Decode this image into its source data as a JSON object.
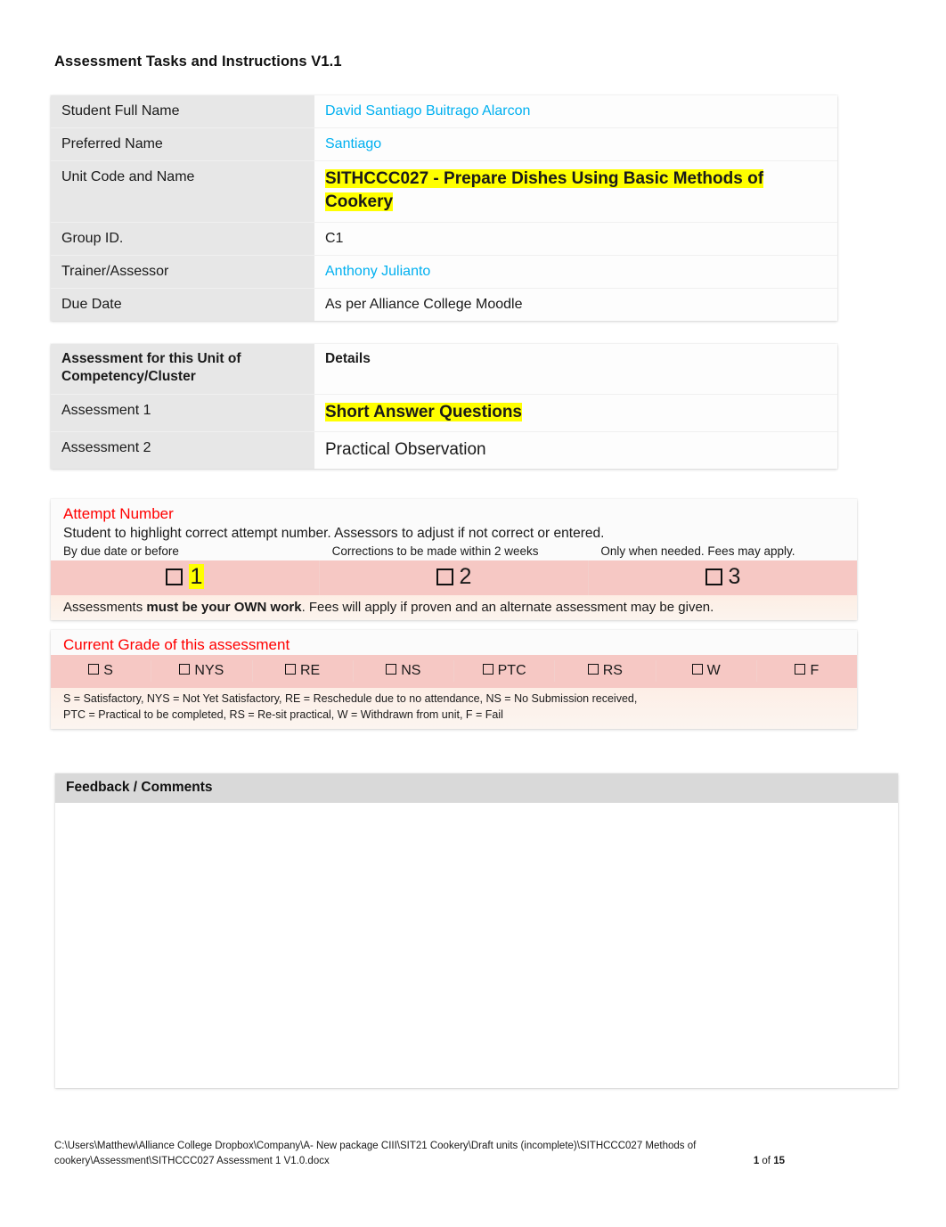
{
  "document": {
    "title": "Assessment Tasks and Instructions V1.1"
  },
  "student_table": {
    "rows": [
      {
        "label": "Student Full Name",
        "value": "David Santiago Buitrago Alarcon",
        "style": "blue"
      },
      {
        "label": "Preferred Name",
        "value": "Santiago",
        "style": "blue"
      },
      {
        "label": "Unit Code and Name",
        "value": "SITHCCC027 - Prepare Dishes Using Basic Methods of Cookery",
        "style": "highlight-yellow-bold"
      },
      {
        "label": "Group ID.",
        "value": "C1",
        "style": "plain"
      },
      {
        "label": "Trainer/Assessor",
        "value": "Anthony Julianto",
        "style": "blue"
      },
      {
        "label": "Due Date",
        "value": "As per Alliance College Moodle",
        "style": "plain"
      }
    ]
  },
  "assessment_table": {
    "header_label": "Assessment for this Unit of Competency/Cluster",
    "header_details": "Details",
    "rows": [
      {
        "label": "Assessment 1",
        "value": "Short Answer Questions",
        "style": "highlight-yellow-bold"
      },
      {
        "label": "Assessment 2",
        "value": "Practical Observation",
        "style": "plain"
      }
    ]
  },
  "attempt_section": {
    "heading": "Attempt Number",
    "instruction": "Student to highlight correct attempt number. Assessors to adjust if not correct or entered.",
    "column_notes": [
      "By due date or before",
      "Corrections to be made within 2 weeks",
      "Only when needed. Fees may apply."
    ],
    "attempts": [
      {
        "number": "1",
        "highlighted": true
      },
      {
        "number": "2",
        "highlighted": false
      },
      {
        "number": "3",
        "highlighted": false
      }
    ],
    "own_work_prefix": "Assessments ",
    "own_work_bold": "must be your OWN work",
    "own_work_suffix": ". Fees will apply if proven and an alternate assessment may be given."
  },
  "grade_section": {
    "heading": "Current Grade of this assessment",
    "grades": [
      "S",
      "NYS",
      "RE",
      "NS",
      "PTC",
      "RS",
      "W",
      "F"
    ],
    "legend_line_1": "S = Satisfactory, NYS = Not Yet Satisfactory, RE = Reschedule due to no attendance, NS = No Submission received,",
    "legend_line_2": " PTC = Practical to be completed, RS = Re-sit practical, W = Withdrawn from unit, F = Fail"
  },
  "feedback_section": {
    "heading": "Feedback / Comments",
    "body": ""
  },
  "footer": {
    "path_line_1": "C:\\Users\\Matthew\\Alliance College Dropbox\\Company\\A- New package CIII\\SIT21 Cookery\\Draft units (incomplete)\\SITHCCC027 Methods of",
    "path_line_2": "cookery\\Assessment\\SITHCCC027 Assessment 1 V1.0.docx",
    "page_current": "1",
    "page_of": " of ",
    "page_total": "15"
  },
  "colors": {
    "accent_blue": "#00b0f0",
    "highlight_yellow": "#ffff00",
    "heading_red": "#ff0000",
    "label_gray": "#e7e7e7",
    "pink_row": "#f6c8c4",
    "feedback_header_gray": "#d9d9d9"
  }
}
